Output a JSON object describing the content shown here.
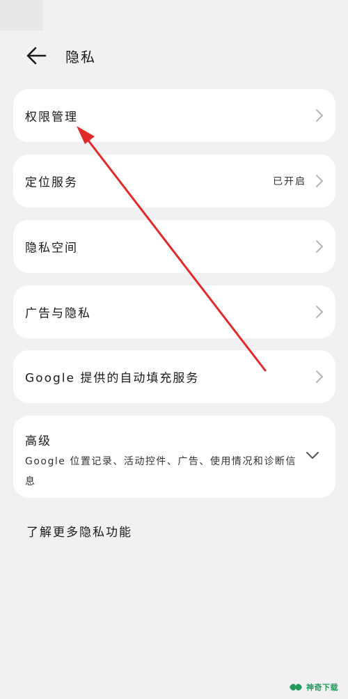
{
  "header": {
    "title": "隐私"
  },
  "menu": [
    {
      "label": "权限管理",
      "status": ""
    },
    {
      "label": "定位服务",
      "status": "已开启"
    },
    {
      "label": "隐私空间",
      "status": ""
    },
    {
      "label": "广告与隐私",
      "status": ""
    },
    {
      "label": "Google 提供的自动填充服务",
      "status": ""
    }
  ],
  "advanced": {
    "title": "高级",
    "description": "Google 位置记录、活动控件、广告、使用情况和诊断信息"
  },
  "learn_more": "了解更多隐私功能",
  "watermark": "神奇下载",
  "colors": {
    "background": "#f1f1f3",
    "card": "#ffffff",
    "annotation_arrow": "#e02a2a",
    "watermark": "#1f9a5a"
  }
}
